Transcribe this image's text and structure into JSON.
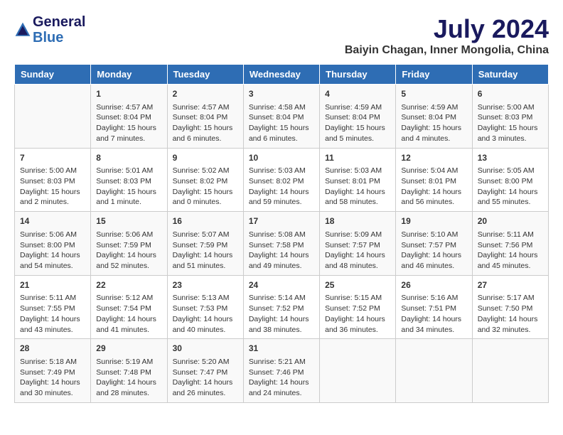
{
  "header": {
    "logo_line1": "General",
    "logo_line2": "Blue",
    "main_title": "July 2024",
    "subtitle": "Baiyin Chagan, Inner Mongolia, China"
  },
  "weekdays": [
    "Sunday",
    "Monday",
    "Tuesday",
    "Wednesday",
    "Thursday",
    "Friday",
    "Saturday"
  ],
  "weeks": [
    [
      {
        "day": "",
        "sunrise": "",
        "sunset": "",
        "daylight": ""
      },
      {
        "day": "1",
        "sunrise": "Sunrise: 4:57 AM",
        "sunset": "Sunset: 8:04 PM",
        "daylight": "Daylight: 15 hours and 7 minutes."
      },
      {
        "day": "2",
        "sunrise": "Sunrise: 4:57 AM",
        "sunset": "Sunset: 8:04 PM",
        "daylight": "Daylight: 15 hours and 6 minutes."
      },
      {
        "day": "3",
        "sunrise": "Sunrise: 4:58 AM",
        "sunset": "Sunset: 8:04 PM",
        "daylight": "Daylight: 15 hours and 6 minutes."
      },
      {
        "day": "4",
        "sunrise": "Sunrise: 4:59 AM",
        "sunset": "Sunset: 8:04 PM",
        "daylight": "Daylight: 15 hours and 5 minutes."
      },
      {
        "day": "5",
        "sunrise": "Sunrise: 4:59 AM",
        "sunset": "Sunset: 8:04 PM",
        "daylight": "Daylight: 15 hours and 4 minutes."
      },
      {
        "day": "6",
        "sunrise": "Sunrise: 5:00 AM",
        "sunset": "Sunset: 8:03 PM",
        "daylight": "Daylight: 15 hours and 3 minutes."
      }
    ],
    [
      {
        "day": "7",
        "sunrise": "Sunrise: 5:00 AM",
        "sunset": "Sunset: 8:03 PM",
        "daylight": "Daylight: 15 hours and 2 minutes."
      },
      {
        "day": "8",
        "sunrise": "Sunrise: 5:01 AM",
        "sunset": "Sunset: 8:03 PM",
        "daylight": "Daylight: 15 hours and 1 minute."
      },
      {
        "day": "9",
        "sunrise": "Sunrise: 5:02 AM",
        "sunset": "Sunset: 8:02 PM",
        "daylight": "Daylight: 15 hours and 0 minutes."
      },
      {
        "day": "10",
        "sunrise": "Sunrise: 5:03 AM",
        "sunset": "Sunset: 8:02 PM",
        "daylight": "Daylight: 14 hours and 59 minutes."
      },
      {
        "day": "11",
        "sunrise": "Sunrise: 5:03 AM",
        "sunset": "Sunset: 8:01 PM",
        "daylight": "Daylight: 14 hours and 58 minutes."
      },
      {
        "day": "12",
        "sunrise": "Sunrise: 5:04 AM",
        "sunset": "Sunset: 8:01 PM",
        "daylight": "Daylight: 14 hours and 56 minutes."
      },
      {
        "day": "13",
        "sunrise": "Sunrise: 5:05 AM",
        "sunset": "Sunset: 8:00 PM",
        "daylight": "Daylight: 14 hours and 55 minutes."
      }
    ],
    [
      {
        "day": "14",
        "sunrise": "Sunrise: 5:06 AM",
        "sunset": "Sunset: 8:00 PM",
        "daylight": "Daylight: 14 hours and 54 minutes."
      },
      {
        "day": "15",
        "sunrise": "Sunrise: 5:06 AM",
        "sunset": "Sunset: 7:59 PM",
        "daylight": "Daylight: 14 hours and 52 minutes."
      },
      {
        "day": "16",
        "sunrise": "Sunrise: 5:07 AM",
        "sunset": "Sunset: 7:59 PM",
        "daylight": "Daylight: 14 hours and 51 minutes."
      },
      {
        "day": "17",
        "sunrise": "Sunrise: 5:08 AM",
        "sunset": "Sunset: 7:58 PM",
        "daylight": "Daylight: 14 hours and 49 minutes."
      },
      {
        "day": "18",
        "sunrise": "Sunrise: 5:09 AM",
        "sunset": "Sunset: 7:57 PM",
        "daylight": "Daylight: 14 hours and 48 minutes."
      },
      {
        "day": "19",
        "sunrise": "Sunrise: 5:10 AM",
        "sunset": "Sunset: 7:57 PM",
        "daylight": "Daylight: 14 hours and 46 minutes."
      },
      {
        "day": "20",
        "sunrise": "Sunrise: 5:11 AM",
        "sunset": "Sunset: 7:56 PM",
        "daylight": "Daylight: 14 hours and 45 minutes."
      }
    ],
    [
      {
        "day": "21",
        "sunrise": "Sunrise: 5:11 AM",
        "sunset": "Sunset: 7:55 PM",
        "daylight": "Daylight: 14 hours and 43 minutes."
      },
      {
        "day": "22",
        "sunrise": "Sunrise: 5:12 AM",
        "sunset": "Sunset: 7:54 PM",
        "daylight": "Daylight: 14 hours and 41 minutes."
      },
      {
        "day": "23",
        "sunrise": "Sunrise: 5:13 AM",
        "sunset": "Sunset: 7:53 PM",
        "daylight": "Daylight: 14 hours and 40 minutes."
      },
      {
        "day": "24",
        "sunrise": "Sunrise: 5:14 AM",
        "sunset": "Sunset: 7:52 PM",
        "daylight": "Daylight: 14 hours and 38 minutes."
      },
      {
        "day": "25",
        "sunrise": "Sunrise: 5:15 AM",
        "sunset": "Sunset: 7:52 PM",
        "daylight": "Daylight: 14 hours and 36 minutes."
      },
      {
        "day": "26",
        "sunrise": "Sunrise: 5:16 AM",
        "sunset": "Sunset: 7:51 PM",
        "daylight": "Daylight: 14 hours and 34 minutes."
      },
      {
        "day": "27",
        "sunrise": "Sunrise: 5:17 AM",
        "sunset": "Sunset: 7:50 PM",
        "daylight": "Daylight: 14 hours and 32 minutes."
      }
    ],
    [
      {
        "day": "28",
        "sunrise": "Sunrise: 5:18 AM",
        "sunset": "Sunset: 7:49 PM",
        "daylight": "Daylight: 14 hours and 30 minutes."
      },
      {
        "day": "29",
        "sunrise": "Sunrise: 5:19 AM",
        "sunset": "Sunset: 7:48 PM",
        "daylight": "Daylight: 14 hours and 28 minutes."
      },
      {
        "day": "30",
        "sunrise": "Sunrise: 5:20 AM",
        "sunset": "Sunset: 7:47 PM",
        "daylight": "Daylight: 14 hours and 26 minutes."
      },
      {
        "day": "31",
        "sunrise": "Sunrise: 5:21 AM",
        "sunset": "Sunset: 7:46 PM",
        "daylight": "Daylight: 14 hours and 24 minutes."
      },
      {
        "day": "",
        "sunrise": "",
        "sunset": "",
        "daylight": ""
      },
      {
        "day": "",
        "sunrise": "",
        "sunset": "",
        "daylight": ""
      },
      {
        "day": "",
        "sunrise": "",
        "sunset": "",
        "daylight": ""
      }
    ]
  ]
}
